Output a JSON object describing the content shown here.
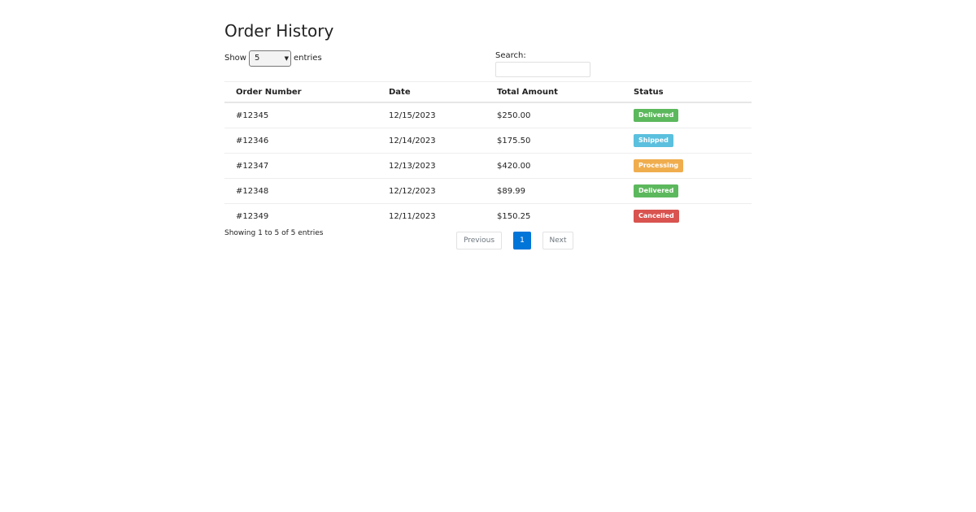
{
  "page": {
    "title": "Order History"
  },
  "controls": {
    "show_label": "Show",
    "length_value": "5",
    "entries_label": "entries",
    "search_label": "Search:",
    "search_value": ""
  },
  "table": {
    "headers": [
      "Order Number",
      "Date",
      "Total Amount",
      "Status"
    ],
    "rows": [
      {
        "order": "#12345",
        "date": "12/15/2023",
        "total": "$250.00",
        "status": "Delivered",
        "status_color": "#5cb85c"
      },
      {
        "order": "#12346",
        "date": "12/14/2023",
        "total": "$175.50",
        "status": "Shipped",
        "status_color": "#5bc0de"
      },
      {
        "order": "#12347",
        "date": "12/13/2023",
        "total": "$420.00",
        "status": "Processing",
        "status_color": "#f0ad4e"
      },
      {
        "order": "#12348",
        "date": "12/12/2023",
        "total": "$89.99",
        "status": "Delivered",
        "status_color": "#5cb85c"
      },
      {
        "order": "#12349",
        "date": "12/11/2023",
        "total": "$150.25",
        "status": "Cancelled",
        "status_color": "#d9534f"
      }
    ]
  },
  "footer": {
    "info": "Showing 1 to 5 of 5 entries",
    "previous_label": "Previous",
    "current_page": "1",
    "next_label": "Next"
  },
  "colors": {
    "accent": "#0275d8"
  }
}
